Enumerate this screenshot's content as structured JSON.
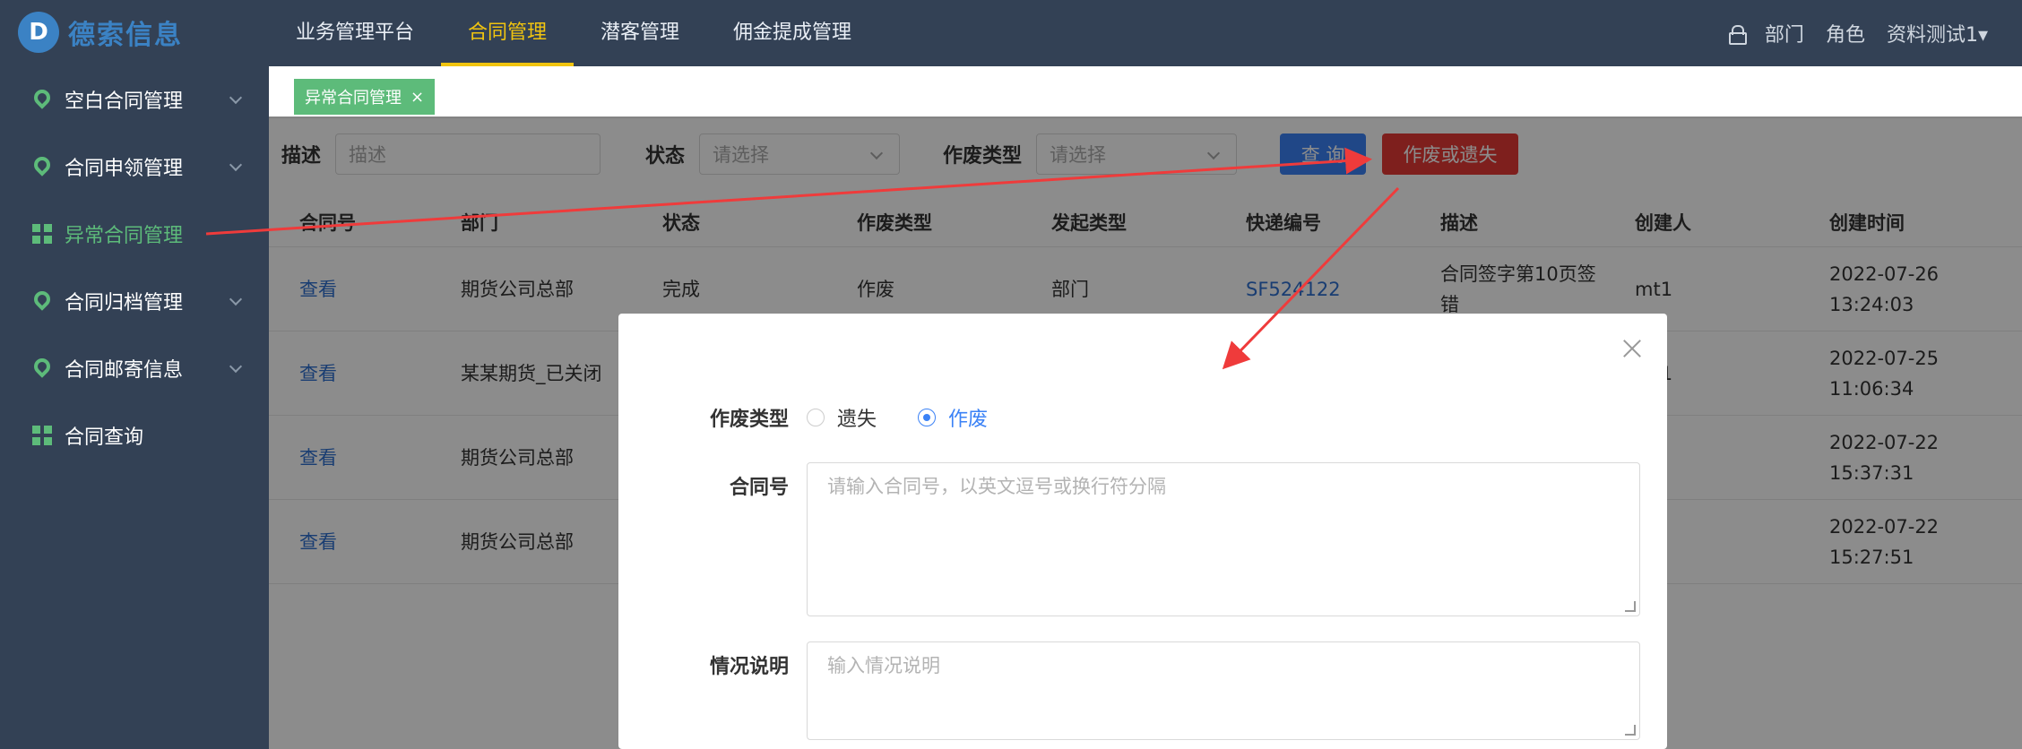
{
  "topbar": {
    "brand": "德索信息",
    "nav": [
      "业务管理平台",
      "合同管理",
      "潜客管理",
      "佣金提成管理"
    ],
    "active_nav": "合同管理",
    "user_links": [
      "部门",
      "角色"
    ],
    "user_name": "资料测试1▾"
  },
  "sidebar": {
    "items": [
      {
        "label": "空白合同管理",
        "icon": "location-pin-icon",
        "expandable": true
      },
      {
        "label": "合同申领管理",
        "icon": "location-pin-icon",
        "expandable": true
      },
      {
        "label": "异常合同管理",
        "icon": "grid-icon",
        "expandable": false,
        "active": true
      },
      {
        "label": "合同归档管理",
        "icon": "location-pin-icon",
        "expandable": true
      },
      {
        "label": "合同邮寄信息",
        "icon": "location-pin-icon",
        "expandable": true
      },
      {
        "label": "合同查询",
        "icon": "grid-icon",
        "expandable": false
      }
    ]
  },
  "tab": {
    "label": "异常合同管理",
    "close": "×"
  },
  "filters": {
    "desc_label": "描述",
    "desc_placeholder": "描述",
    "status_label": "状态",
    "status_placeholder": "请选择",
    "void_type_label": "作废类型",
    "void_type_placeholder": "请选择",
    "query_button": "查 询",
    "void_lost_button": "作废或遗失"
  },
  "table": {
    "headers": [
      "合同号",
      "部门",
      "状态",
      "作废类型",
      "发起类型",
      "快递编号",
      "描述",
      "创建人",
      "创建时间"
    ],
    "rows": [
      {
        "contract": "查看",
        "dept": "期货公司总部",
        "status": "完成",
        "void_type": "作废",
        "origin": "部门",
        "express": "SF524122",
        "desc": "合同签字第10页签错",
        "creator": "mt1",
        "created": "2022-07-26 13:24:03"
      },
      {
        "contract": "查看",
        "dept": "某某期货_已关闭",
        "status": "",
        "void_type": "",
        "origin": "",
        "express": "",
        "desc": "",
        "creator": "mt1",
        "created": "2022-07-25 11:06:34"
      },
      {
        "contract": "查看",
        "dept": "期货公司总部",
        "status": "",
        "void_type": "",
        "origin": "",
        "express": "",
        "desc": "",
        "creator": "",
        "created": "2022-07-22 15:37:31"
      },
      {
        "contract": "查看",
        "dept": "期货公司总部",
        "status": "",
        "void_type": "",
        "origin": "",
        "express": "",
        "desc": "",
        "creator": "",
        "created": "2022-07-22 15:27:51"
      }
    ]
  },
  "modal": {
    "void_type_label": "作废类型",
    "options": [
      "遗失",
      "作废"
    ],
    "selected": "作废",
    "contract_label": "合同号",
    "contract_placeholder": "请输入合同号，以英文逗号或换行符分隔",
    "note_label": "情况说明",
    "note_placeholder": "输入情况说明"
  },
  "colors": {
    "nav_bg": "#334155",
    "accent_green": "#5dbb7a",
    "nav_active": "#f1c40f",
    "primary_blue": "#3b82f6",
    "danger_red": "#e53935",
    "annotation_arrow": "#ef3b3b"
  }
}
